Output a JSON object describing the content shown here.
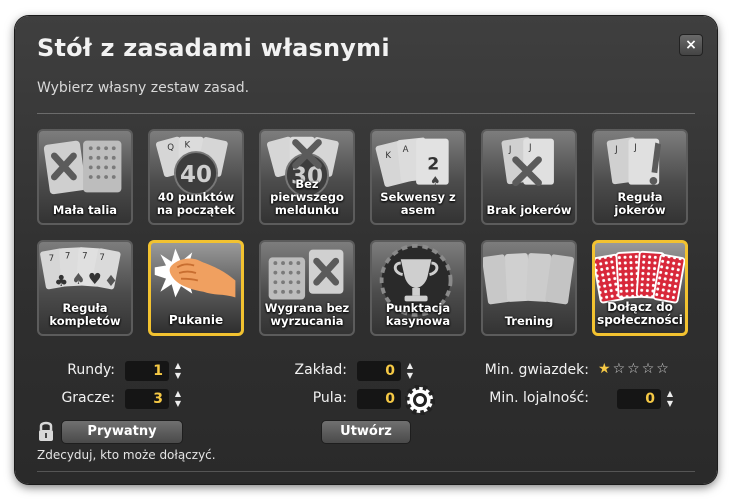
{
  "dialog": {
    "title": "Stół z zasadami własnymi",
    "subtitle": "Wybierz własny zestaw zasad.",
    "close_label": "×"
  },
  "rules": [
    {
      "label": "Mała talia",
      "selected": false,
      "icon": "small-deck-icon"
    },
    {
      "label": "40 punktów na początek",
      "selected": false,
      "icon": "forty-points-icon",
      "badge": "40"
    },
    {
      "label": "Bez pierwszego meldunku",
      "selected": false,
      "icon": "no-first-meld-icon",
      "badge": "30"
    },
    {
      "label": "Sekwensy z asem",
      "selected": false,
      "icon": "ace-sequence-icon"
    },
    {
      "label": "Brak jokerów",
      "selected": false,
      "icon": "no-jokers-icon"
    },
    {
      "label": "Reguła jokerów",
      "selected": false,
      "icon": "joker-rule-icon"
    },
    {
      "label": "Reguła kompletów",
      "selected": false,
      "icon": "sets-rule-icon"
    },
    {
      "label": "Pukanie",
      "selected": true,
      "icon": "knock-icon"
    },
    {
      "label": "Wygrana bez wyrzucania",
      "selected": false,
      "icon": "win-without-discard-icon"
    },
    {
      "label": "Punktacja kasynowa",
      "selected": false,
      "icon": "casino-scoring-icon"
    },
    {
      "label": "Trening",
      "selected": false,
      "icon": "training-icon"
    },
    {
      "label": "Dołącz do społeczności",
      "selected": true,
      "icon": "community-icon"
    }
  ],
  "settings": {
    "rounds": {
      "label": "Rundy:",
      "value": "1"
    },
    "players": {
      "label": "Gracze:",
      "value": "3"
    },
    "stake": {
      "label": "Zakład:",
      "value": "0"
    },
    "pot": {
      "label": "Pula:",
      "value": "0"
    },
    "min_stars": {
      "label": "Min. gwiazdek:",
      "value": 1,
      "max": 5
    },
    "min_loyalty": {
      "label": "Min. lojalność:",
      "value": "0"
    }
  },
  "buttons": {
    "private": "Prywatny",
    "create": "Utwórz"
  },
  "hint": "Zdecyduj, kto może dołączyć.",
  "colors": {
    "accent": "#f2c230",
    "value_text": "#f6c945",
    "dialog_bg": "#3a3a3a"
  }
}
